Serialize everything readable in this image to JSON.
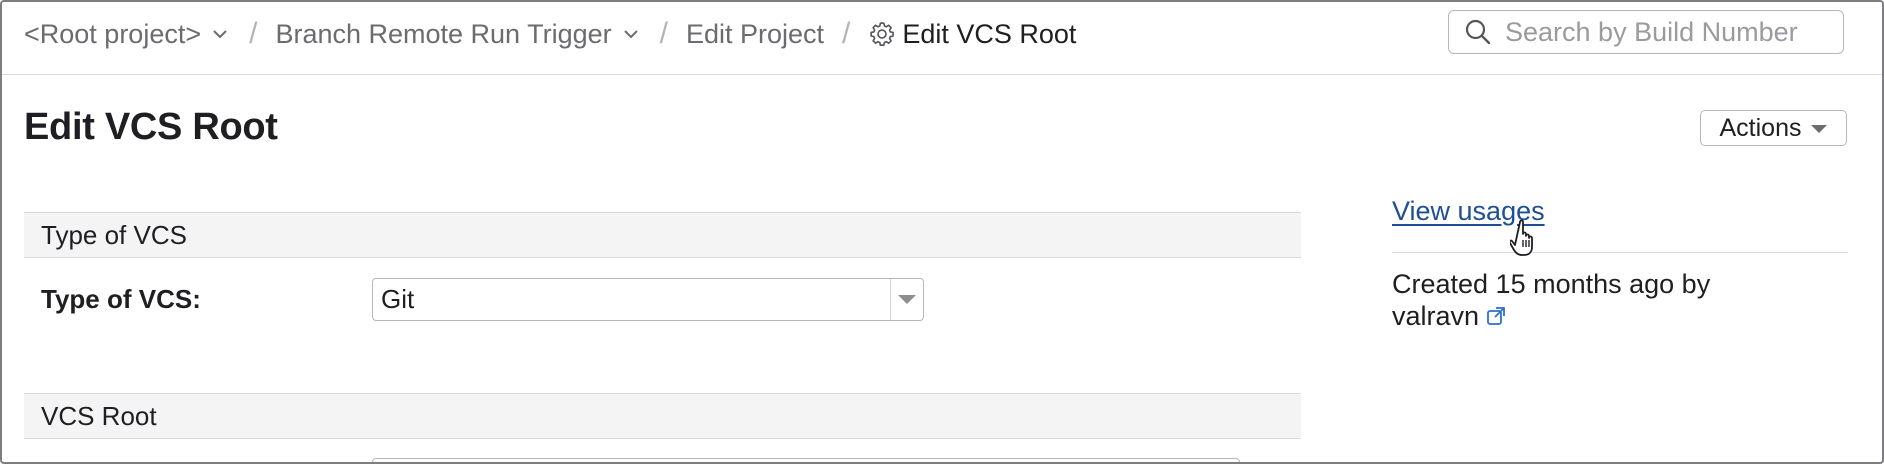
{
  "breadcrumbs": {
    "root_project": "<Root project>",
    "project": "Branch Remote Run Trigger",
    "edit_project": "Edit Project",
    "separator": "/",
    "current": "Edit VCS Root"
  },
  "search": {
    "placeholder": "Search by Build Number"
  },
  "page": {
    "title": "Edit VCS Root",
    "actions_label": "Actions"
  },
  "form": {
    "section_type_of_vcs": "Type of VCS",
    "type_of_vcs_label": "Type of VCS:",
    "type_of_vcs_value": "Git",
    "section_vcs_root": "VCS Root"
  },
  "sidebar": {
    "view_usages": "View usages",
    "created_text": "Created 15 months ago by",
    "created_by": "valravn"
  },
  "icons": {
    "gear": "gear-icon",
    "search": "search-icon",
    "chevron": "chevron-down-icon",
    "external": "external-link-icon",
    "cursor": "hand-pointer-cursor"
  },
  "colors": {
    "link": "#1e4f94",
    "section_bg": "#f4f4f5",
    "border": "#d9d9dc"
  }
}
